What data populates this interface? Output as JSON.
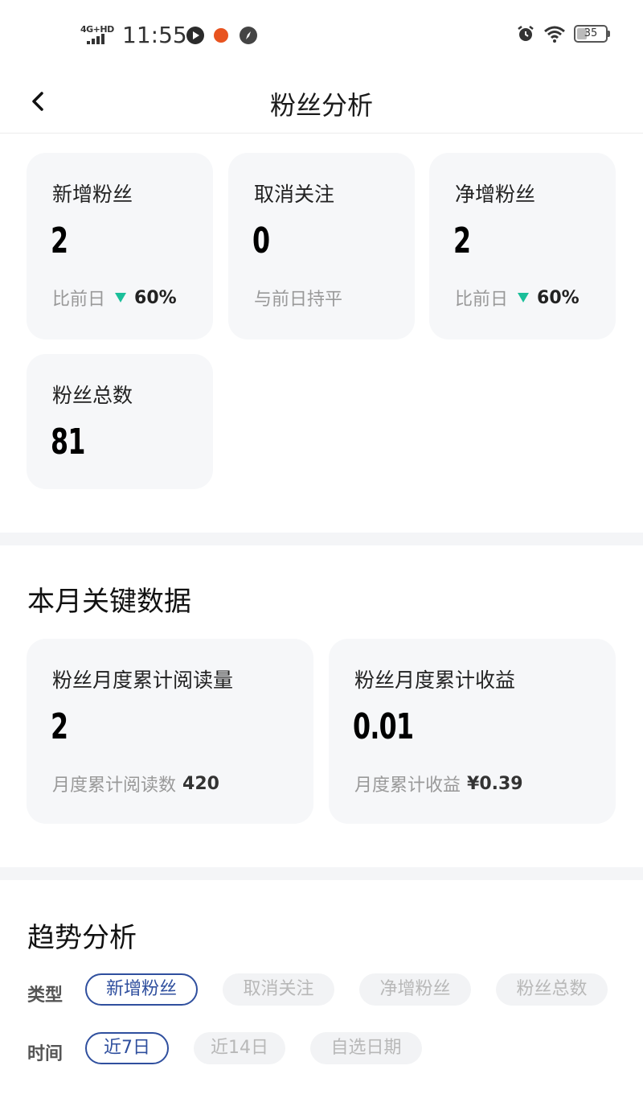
{
  "status_bar": {
    "network": "4G+HD",
    "time": "11:55",
    "battery": "35",
    "colors": {
      "app1": "#2b2b2b",
      "app2": "#e8531f",
      "app3": "#444444"
    }
  },
  "nav": {
    "title": "粉丝分析",
    "back_icon": "chevron-left-icon"
  },
  "overview": {
    "cards": [
      {
        "label": "新增粉丝",
        "value": "2",
        "compare_text": "比前日",
        "compare_pct": "60%"
      },
      {
        "label": "取消关注",
        "value": "0",
        "compare_text": "与前日持平"
      },
      {
        "label": "净增粉丝",
        "value": "2",
        "compare_text": "比前日",
        "compare_pct": "60%"
      },
      {
        "label": "粉丝总数",
        "value": "81"
      }
    ],
    "down_color": "#1bbf9a"
  },
  "monthly": {
    "title": "本月关键数据",
    "cards": [
      {
        "label": "粉丝月度累计阅读量",
        "value": "2",
        "sub_label": "月度累计阅读数",
        "sub_value": "420"
      },
      {
        "label": "粉丝月度累计收益",
        "value": "0.01",
        "sub_label": "月度累计收益",
        "sub_value": "¥0.39"
      }
    ]
  },
  "trend": {
    "title": "趋势分析",
    "type_label": "类型",
    "types": [
      "新增粉丝",
      "取消关注",
      "净增粉丝",
      "粉丝总数"
    ],
    "selected_type": "新增粉丝",
    "time_label": "时间",
    "times": [
      "近7日",
      "近14日",
      "自选日期"
    ],
    "selected_time": "近7日",
    "accent": "#2f4f9e"
  }
}
